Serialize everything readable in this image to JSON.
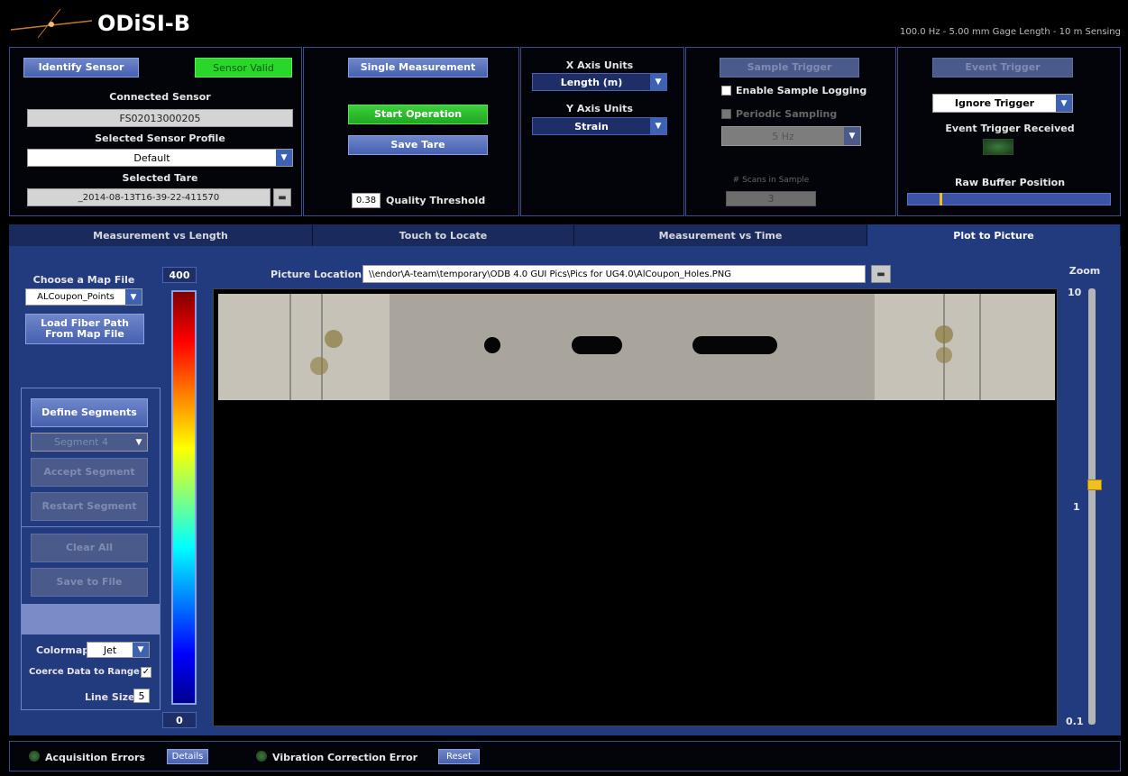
{
  "app": {
    "title": "ODiSI-B",
    "header_info": "100.0 Hz - 5.00 mm Gage Length - 10 m Sensing"
  },
  "sensor": {
    "identify_label": "Identify Sensor",
    "valid_label": "Sensor Valid",
    "connected_label": "Connected Sensor",
    "connected_value": "FS02013000205",
    "profile_label": "Selected Sensor Profile",
    "profile_value": "Default",
    "tare_label": "Selected Tare",
    "tare_value": "_2014-08-13T16-39-22-411570"
  },
  "measure": {
    "single_label": "Single Measurement",
    "start_label": "Start Operation",
    "save_tare_label": "Save Tare",
    "quality_value": "0.38",
    "quality_label": "Quality Threshold"
  },
  "axes": {
    "x_label": "X Axis Units",
    "x_value": "Length (m)",
    "y_label": "Y Axis Units",
    "y_value": "Strain"
  },
  "sample": {
    "trigger_label": "Sample Trigger",
    "logging_label": "Enable Sample Logging",
    "periodic_label": "Periodic Sampling",
    "rate_value": "5 Hz",
    "scans_label": "# Scans in Sample",
    "scans_value": "3"
  },
  "event": {
    "trigger_label": "Event Trigger",
    "mode_value": "Ignore Trigger",
    "received_label": "Event Trigger Received",
    "buffer_label": "Raw Buffer Position",
    "buffer_fraction": 0.16
  },
  "tabs": [
    {
      "label": "Measurement vs Length"
    },
    {
      "label": "Touch to Locate"
    },
    {
      "label": "Measurement vs Time"
    },
    {
      "label": "Plot to Picture"
    }
  ],
  "map": {
    "choose_label": "Choose a Map File",
    "file_value": "ALCoupon_Points",
    "load_label": "Load Fiber Path From Map File",
    "define_label": "Define Segments",
    "segment_value": "Segment 4",
    "accept_label": "Accept Segment",
    "restart_label": "Restart Segment",
    "clear_label": "Clear All",
    "save_label": "Save to File",
    "colormap_label": "Colormap",
    "colormap_value": "Jet",
    "coerce_label": "Coerce Data to Range",
    "line_size_label": "Line Size",
    "line_size_value": "5"
  },
  "scale": {
    "max": "400",
    "min": "0"
  },
  "picture": {
    "location_label": "Picture Location",
    "path": "\\\\endor\\A-team\\temporary\\ODB 4.0 GUI Pics\\Pics for UG4.0\\AlCoupon_Holes.PNG"
  },
  "zoom": {
    "label": "Zoom",
    "max": "10",
    "mid": "1",
    "min": "0.1"
  },
  "status": {
    "acq_label": "Acquisition Errors",
    "details_label": "Details",
    "vib_label": "Vibration Correction Error",
    "reset_label": "Reset"
  },
  "colors": {
    "accent": "#4661b0",
    "valid_green": "#29d629",
    "tab_active": "#223a7e"
  }
}
